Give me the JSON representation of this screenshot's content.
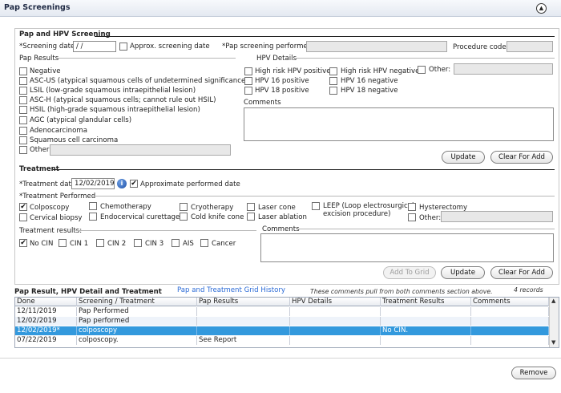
{
  "header": {
    "title": "Pap Screenings"
  },
  "pap": {
    "section_title": "Pap and HPV Screening",
    "screening_date_label": "*Screening date:",
    "screening_date_value": " / /",
    "approx_label": "Approx. screening date",
    "performed_label": "*Pap screening performed:",
    "procedure_code_label": "Procedure code:",
    "results_title": "Pap Results",
    "results": [
      "Negative",
      "ASC-US (atypical squamous cells of undetermined significance)",
      "LSIL (low-grade squamous intraepithelial lesion)",
      "ASC-H (atypical squamous cells; cannot rule out HSIL)",
      "HSIL (high-grade squamous intraepithelial lesion)",
      "AGC (atypical glandular cells)",
      "Adenocarcinoma",
      "Squamous cell carcinoma",
      "Other:"
    ],
    "hpv_title": "HPV Details",
    "hpv": [
      "High risk HPV positive",
      "High risk HPV negative",
      "HPV 16 positive",
      "HPV 16 negative",
      "HPV 18 positive",
      "HPV 18 negative"
    ],
    "hpv_other": "Other:",
    "comments_label": "Comments",
    "update_label": "Update",
    "clear_label": "Clear For Add"
  },
  "treatment": {
    "section_title": "Treatment",
    "date_label": "*Treatment date:",
    "date_value": "12/02/2019",
    "approx_label": "Approximate performed date",
    "approx_checked": "✔",
    "performed_title": "*Treatment Performed",
    "items": [
      "Colposcopy",
      "Chemotherapy",
      "Cryotherapy",
      "Laser cone",
      "Cervical biopsy",
      "Endocervical curettage",
      "Cold knife cone",
      "Laser ablation",
      "LEEP (Loop electrosurgical",
      "excision procedure)",
      "Hysterectomy",
      "Other:"
    ],
    "colposcopy_checked": "✔",
    "results_title": "Treatment results:",
    "results": [
      "No CIN",
      "CIN 1",
      "CIN 2",
      "CIN 3",
      "AIS",
      "Cancer"
    ],
    "no_cin_checked": "✔",
    "comments_label": "Comments",
    "add_label": "Add To Grid",
    "update_label": "Update",
    "clear_label": "Clear For Add"
  },
  "grid": {
    "title": "Pap Result, HPV Detail and Treatment",
    "history_link": "Pap and Treatment Grid History",
    "note": "These comments pull from both comments section above.",
    "records": "4 records",
    "columns": [
      "Done",
      "Screening / Treatment",
      "Pap Results",
      "HPV Details",
      "Treatment Results",
      "Comments"
    ],
    "rows": [
      [
        "12/11/2019",
        "Pap Performed",
        "",
        "",
        "",
        ""
      ],
      [
        "12/02/2019",
        "Pap performed",
        "",
        "",
        "",
        ""
      ],
      [
        "12/02/2019*",
        "colposcopy",
        "",
        "",
        "No CIN.",
        ""
      ],
      [
        "07/22/2019",
        "colposcopy.",
        "See Report",
        "",
        "",
        ""
      ]
    ]
  },
  "footer": {
    "remove_label": "Remove"
  },
  "colors": {
    "selected_row": "#3399dd",
    "link": "#2a6ad6"
  }
}
